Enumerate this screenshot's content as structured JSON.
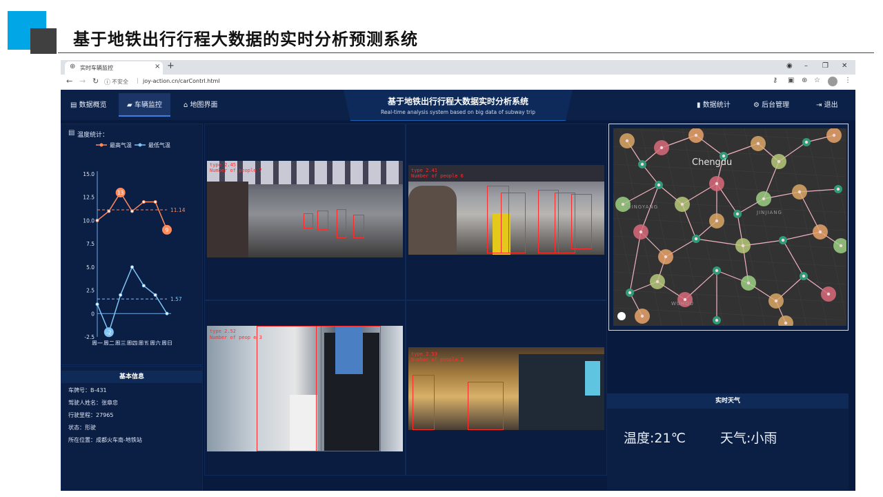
{
  "slide": {
    "title": "基于地铁出行行程大数据的实时分析预测系统"
  },
  "browser": {
    "tab_title": "实时车辆监控",
    "insecure_label": "不安全",
    "url": "joy-action.cn/carContrl.html"
  },
  "nav": {
    "left": [
      {
        "label": "数据概览",
        "icon": "document-icon"
      },
      {
        "label": "车辆监控",
        "icon": "truck-icon",
        "active": true
      },
      {
        "label": "地图界面",
        "icon": "bank-icon"
      }
    ],
    "right": [
      {
        "label": "数据统计",
        "icon": "bar-chart-icon"
      },
      {
        "label": "后台管理",
        "icon": "gear-icon"
      },
      {
        "label": "退出",
        "icon": "exit-icon"
      }
    ]
  },
  "header": {
    "title": "基于地铁出行行程大数据实时分析系统",
    "subtitle": "Real-time analysis system based on big data of subway trip"
  },
  "temperature": {
    "section_title": "温度统计："
  },
  "chart_data": {
    "type": "line",
    "categories": [
      "周一",
      "周二",
      "周三",
      "周四",
      "周五",
      "周六",
      "周日"
    ],
    "series": [
      {
        "name": "最高气温",
        "values": [
          10,
          11,
          13,
          11,
          12,
          12,
          9
        ],
        "color": "#ff8a5b",
        "average": 11.14,
        "max_label": "13",
        "min_label": "9"
      },
      {
        "name": "最低气温",
        "values": [
          1,
          -2,
          2,
          5,
          3,
          2,
          0
        ],
        "color": "#7ec4f5",
        "average": 1.57,
        "min_label": "-2"
      }
    ],
    "ylim": [
      -2.5,
      15
    ],
    "yticks": [
      "15.0",
      "12.5",
      "10.0",
      "7.5",
      "5.0",
      "2.5",
      "0",
      "-2.5"
    ],
    "mean_labels": [
      "11.14",
      "1.57"
    ],
    "legend_position": "top"
  },
  "info": {
    "title": "基本信息",
    "rows": [
      "车牌号：B-431",
      "驾驶人姓名：张章忠",
      "行驶里程：27965",
      "状态：形驶",
      "所在位置：成都火车南-地铁站"
    ]
  },
  "videos": [
    {
      "labels": [
        "type 2.45",
        "Number of people 7"
      ]
    },
    {
      "labels": [
        "type 2.41",
        "Number of people 6"
      ]
    },
    {
      "labels": [
        "type 2.52",
        "Number of peop e 3"
      ]
    },
    {
      "labels": [
        "type 2.53",
        "Number of people 2"
      ]
    }
  ],
  "map": {
    "city_label": "Chengdu",
    "district_labels": [
      "QINGYANG",
      "JINJIANG",
      "WUHOU"
    ]
  },
  "weather": {
    "title": "实时天气",
    "temperature": "温度:21℃",
    "condition": "天气:小雨"
  }
}
